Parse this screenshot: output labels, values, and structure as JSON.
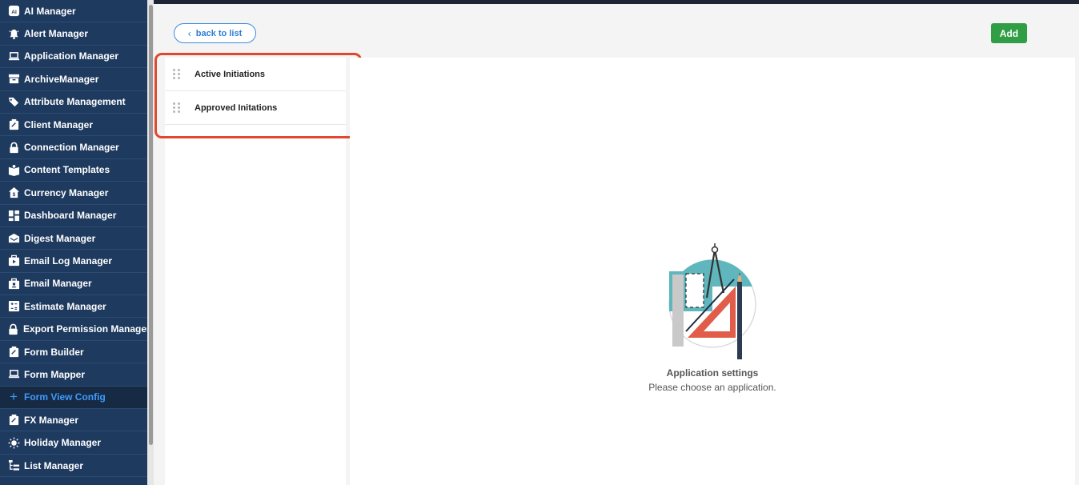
{
  "sidebar": {
    "items": [
      {
        "label": "AI Manager",
        "icon": "ai-icon"
      },
      {
        "label": "Alert Manager",
        "icon": "bell-icon"
      },
      {
        "label": "Application Manager",
        "icon": "laptop-icon"
      },
      {
        "label": "ArchiveManager",
        "icon": "archive-icon"
      },
      {
        "label": "Attribute Management",
        "icon": "tags-icon"
      },
      {
        "label": "Client Manager",
        "icon": "clipboard-icon"
      },
      {
        "label": "Connection Manager",
        "icon": "lock-icon"
      },
      {
        "label": "Content Templates",
        "icon": "book-icon"
      },
      {
        "label": "Currency Manager",
        "icon": "currency-house-icon"
      },
      {
        "label": "Dashboard Manager",
        "icon": "dashboard-icon"
      },
      {
        "label": "Digest Manager",
        "icon": "digest-icon"
      },
      {
        "label": "Email Log Manager",
        "icon": "briefcase-play-icon"
      },
      {
        "label": "Email Manager",
        "icon": "briefcase-user-icon"
      },
      {
        "label": "Estimate Manager",
        "icon": "calculator-icon"
      },
      {
        "label": "Export Permission Manager",
        "icon": "lock-icon"
      },
      {
        "label": "Form Builder",
        "icon": "clipboard-icon"
      },
      {
        "label": "Form Mapper",
        "icon": "laptop-icon"
      },
      {
        "label": "Form View Config",
        "icon": "plus-icon",
        "active": true
      },
      {
        "label": "FX Manager",
        "icon": "clipboard-icon"
      },
      {
        "label": "Holiday Manager",
        "icon": "sun-icon"
      },
      {
        "label": "List Manager",
        "icon": "list-tree-icon"
      }
    ]
  },
  "header": {
    "back_label": "back to list",
    "add_label": "Add"
  },
  "list": {
    "items": [
      {
        "label": "Active Initiations"
      },
      {
        "label": "Approved Initations"
      }
    ]
  },
  "empty_state": {
    "title": "Application settings",
    "subtitle": "Please choose an application."
  },
  "colors": {
    "sidebar_bg": "#1e3a5f",
    "active_accent": "#3d9bff",
    "add_button": "#2f9e44",
    "highlight": "#e0492d"
  }
}
